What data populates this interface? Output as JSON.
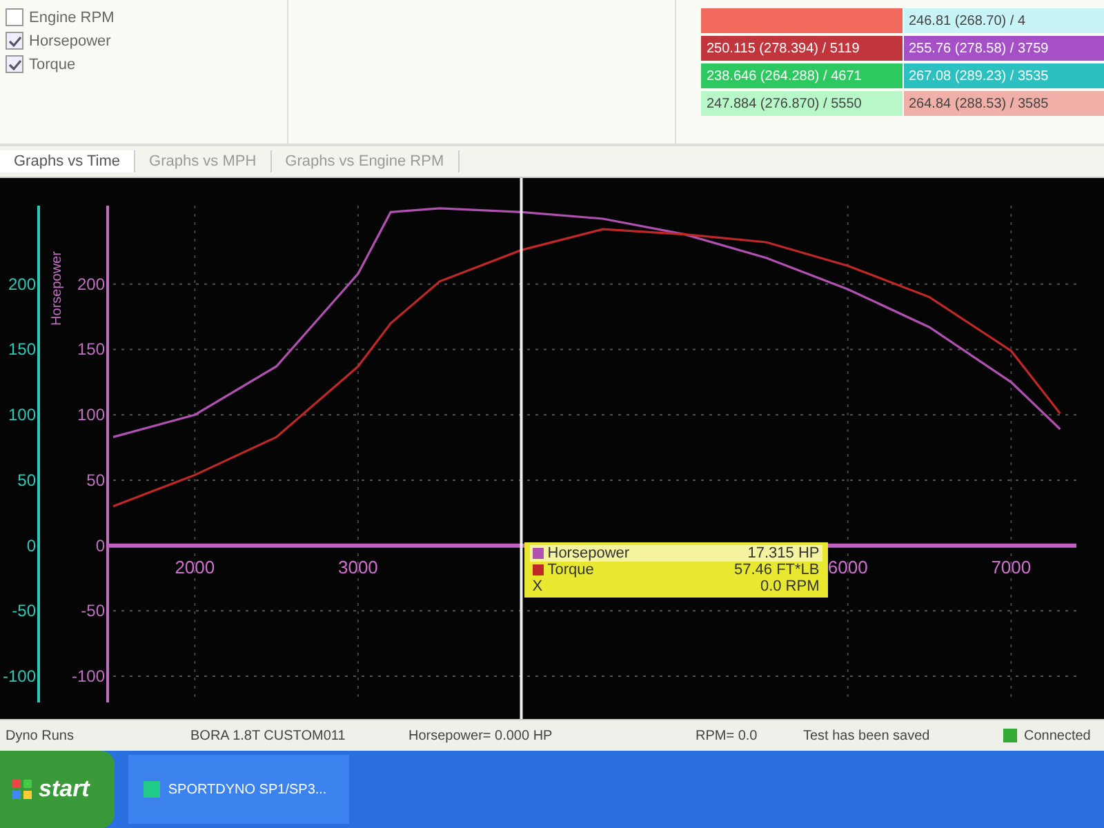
{
  "options": [
    {
      "label": "Engine RPM",
      "checked": false
    },
    {
      "label": "Horsepower",
      "checked": true
    },
    {
      "label": "Torque",
      "checked": true
    }
  ],
  "results": [
    {
      "color": "#f26a5e"
    },
    {
      "text": "246.81 (268.70) / 4",
      "color": "#c8f4f8"
    },
    {
      "text": "250.115 (278.394) / 5119",
      "color": "#c0363c"
    },
    {
      "text": "255.76 (278.58) / 3759",
      "color": "#a650c8"
    },
    {
      "text": "238.646 (264.288) / 4671",
      "color": "#2ec860"
    },
    {
      "text": "267.08 (289.23) / 3535",
      "color": "#2cc0c0"
    },
    {
      "text": "247.884 (276.870) / 5550",
      "color": "#b8f8c8"
    },
    {
      "text": "264.84 (288.53) / 3585",
      "color": "#f0b0a8"
    }
  ],
  "tabs": [
    {
      "label": "Graphs vs Time",
      "selected": true
    },
    {
      "label": "Graphs vs MPH",
      "selected": false
    },
    {
      "label": "Graphs vs Engine RPM",
      "selected": false
    }
  ],
  "graph": {
    "secondary_axis_ticks": [
      "200",
      "150",
      "100",
      "50",
      "0",
      "-50",
      "-100"
    ],
    "cursor_readout": [
      {
        "value": "17.315 HP",
        "selected": true
      },
      {
        "value": "57.46 FT*LB",
        "selected": false
      },
      {
        "label": "X",
        "value": "0.0 RPM",
        "selected": false
      }
    ],
    "chart_data": {
      "type": "line",
      "ylabel": "Horsepower",
      "x": [
        1500,
        2000,
        2500,
        3000,
        3200,
        3500,
        4000,
        4500,
        5000,
        5500,
        6000,
        6500,
        7000,
        7300
      ],
      "series": [
        {
          "name": "Horsepower",
          "color": "#b050b0",
          "values": [
            83,
            100,
            137,
            208,
            255,
            258,
            255,
            250,
            238,
            220,
            196,
            167,
            125,
            89
          ]
        },
        {
          "name": "Torque",
          "color": "#c02828",
          "values": [
            30,
            54,
            83,
            137,
            170,
            202,
            226,
            242,
            238,
            232,
            214,
            190,
            149,
            101
          ]
        }
      ],
      "xlim": [
        1500,
        7400
      ],
      "ylim": [
        -120,
        260
      ],
      "xticks": [
        2000,
        3000,
        6000,
        7000
      ],
      "yticks": [
        -100,
        -50,
        0,
        50,
        100,
        150,
        200
      ],
      "grid": true,
      "legend": "lower center",
      "ref_lines": [
        {
          "axis": "x",
          "value": 4000
        }
      ]
    }
  },
  "status_bar": {
    "panel": "Dyno Runs",
    "run": "BORA 1.8T CUSTOM011",
    "horsepower": "Horsepower= 0.000 HP",
    "rpm": "RPM= 0.0",
    "message": "Test has been saved",
    "connection": "Connected"
  },
  "taskbar": {
    "start": "start",
    "task": "SPORTDYNO SP1/SP3..."
  }
}
